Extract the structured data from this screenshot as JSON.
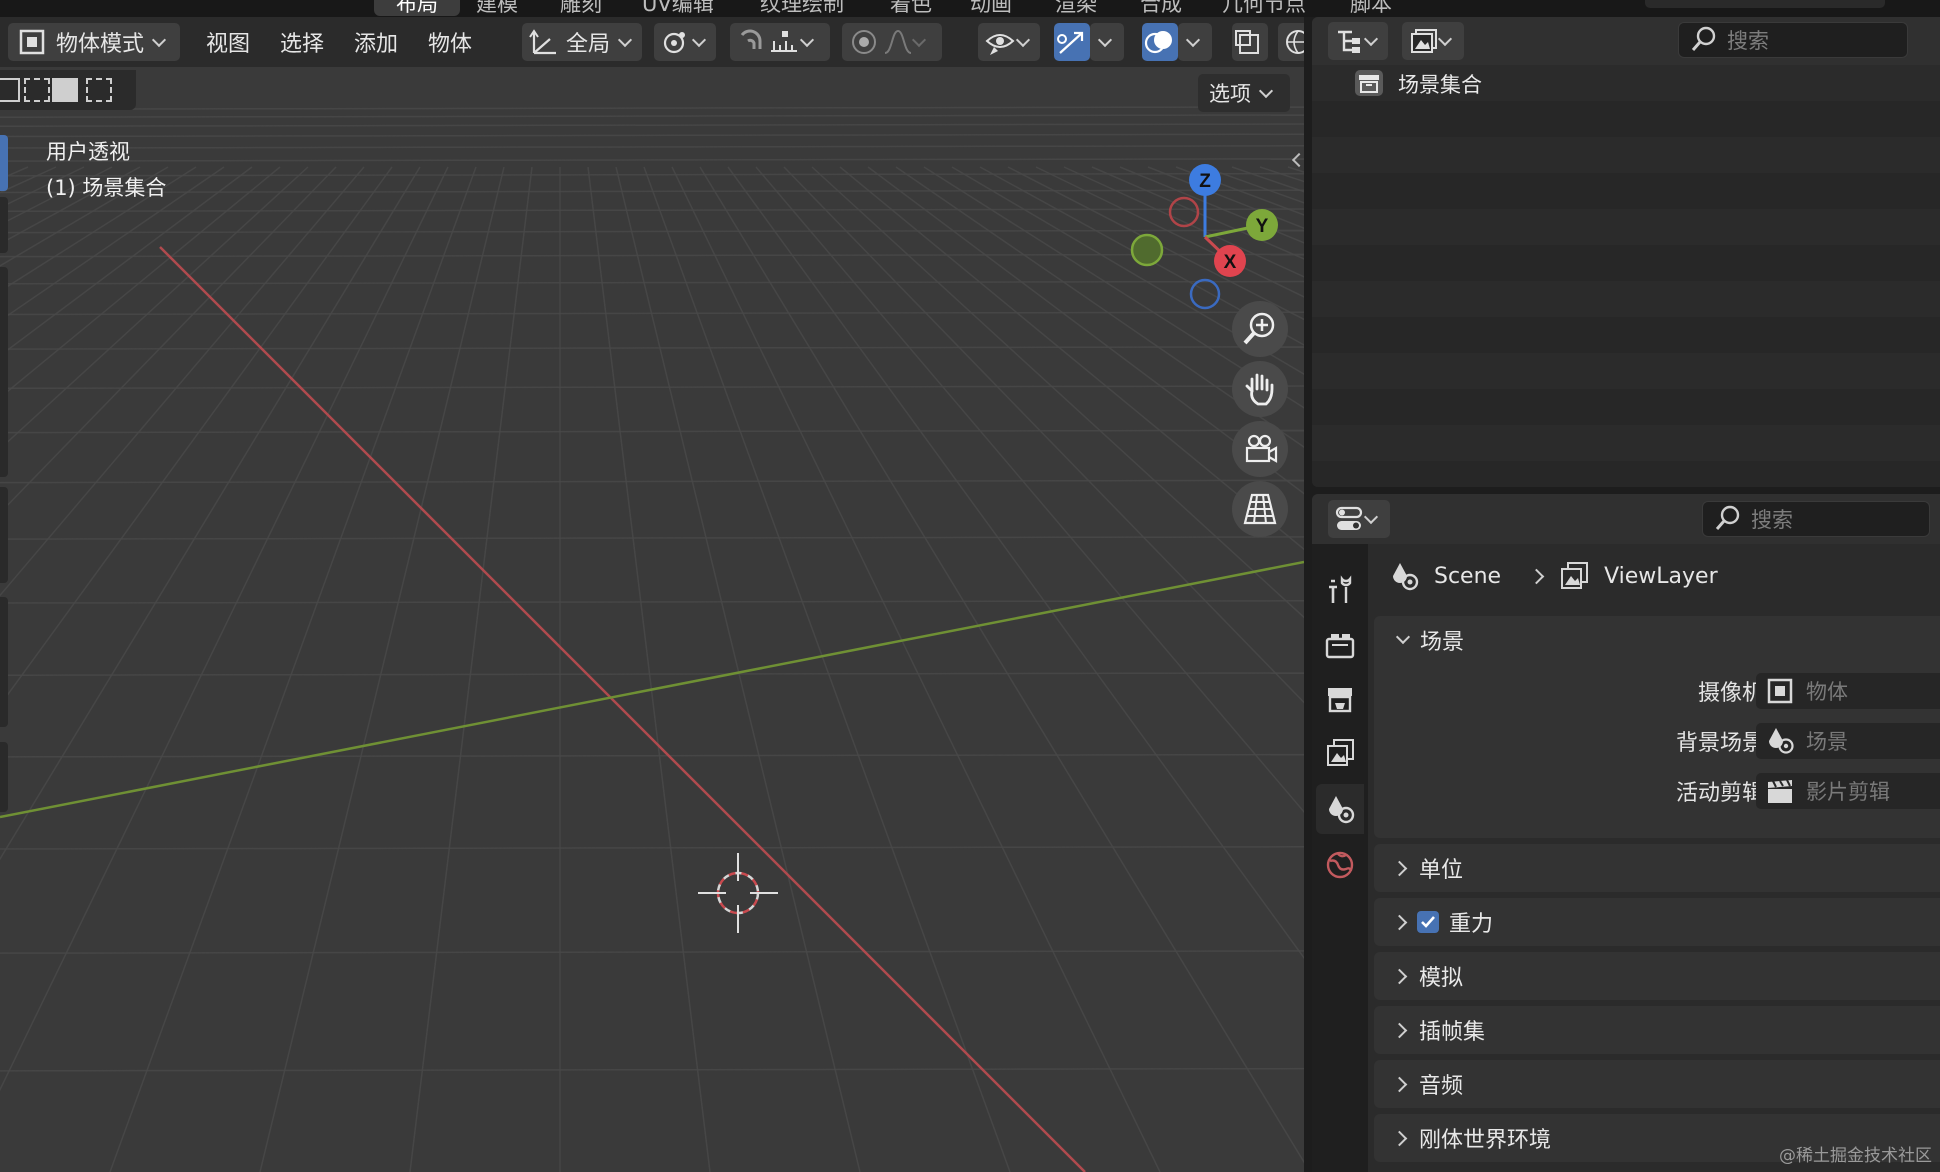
{
  "top_tabs": [
    "布局",
    "建模",
    "雕刻",
    "UV编辑",
    "纹理绘制",
    "着色",
    "动画",
    "渲染",
    "合成",
    "几何节点",
    "脚本"
  ],
  "viewport": {
    "mode_label": "物体模式",
    "menu": {
      "view": "视图",
      "select": "选择",
      "add": "添加",
      "object": "物体"
    },
    "transform_orientation": "全局",
    "options_label": "选项",
    "info_line1": "用户透视",
    "info_line2": "(1) 场景集合",
    "gizmo": {
      "z": "Z",
      "y": "Y",
      "x": "X"
    }
  },
  "outliner": {
    "search_placeholder": "搜索",
    "root_item": "场景集合"
  },
  "properties": {
    "search_placeholder": "搜索",
    "breadcrumb": {
      "scene": "Scene",
      "view_layer": "ViewLayer"
    },
    "scene_panel": {
      "title": "场景",
      "rows": [
        {
          "label": "摄像机",
          "value": "物体"
        },
        {
          "label": "背景场景",
          "value": "场景"
        },
        {
          "label": "活动剪辑",
          "value": "影片剪辑"
        }
      ]
    },
    "collapsed_panels": [
      "单位",
      "重力",
      "模拟",
      "插帧集",
      "音频",
      "刚体世界环境"
    ],
    "gravity_checked": true
  },
  "watermark": "@稀土掘金技术社区",
  "colors": {
    "accent": "#4772b3",
    "axis_x": "#c94a4f",
    "axis_y": "#7da83a",
    "axis_z": "#3d7ce0"
  }
}
